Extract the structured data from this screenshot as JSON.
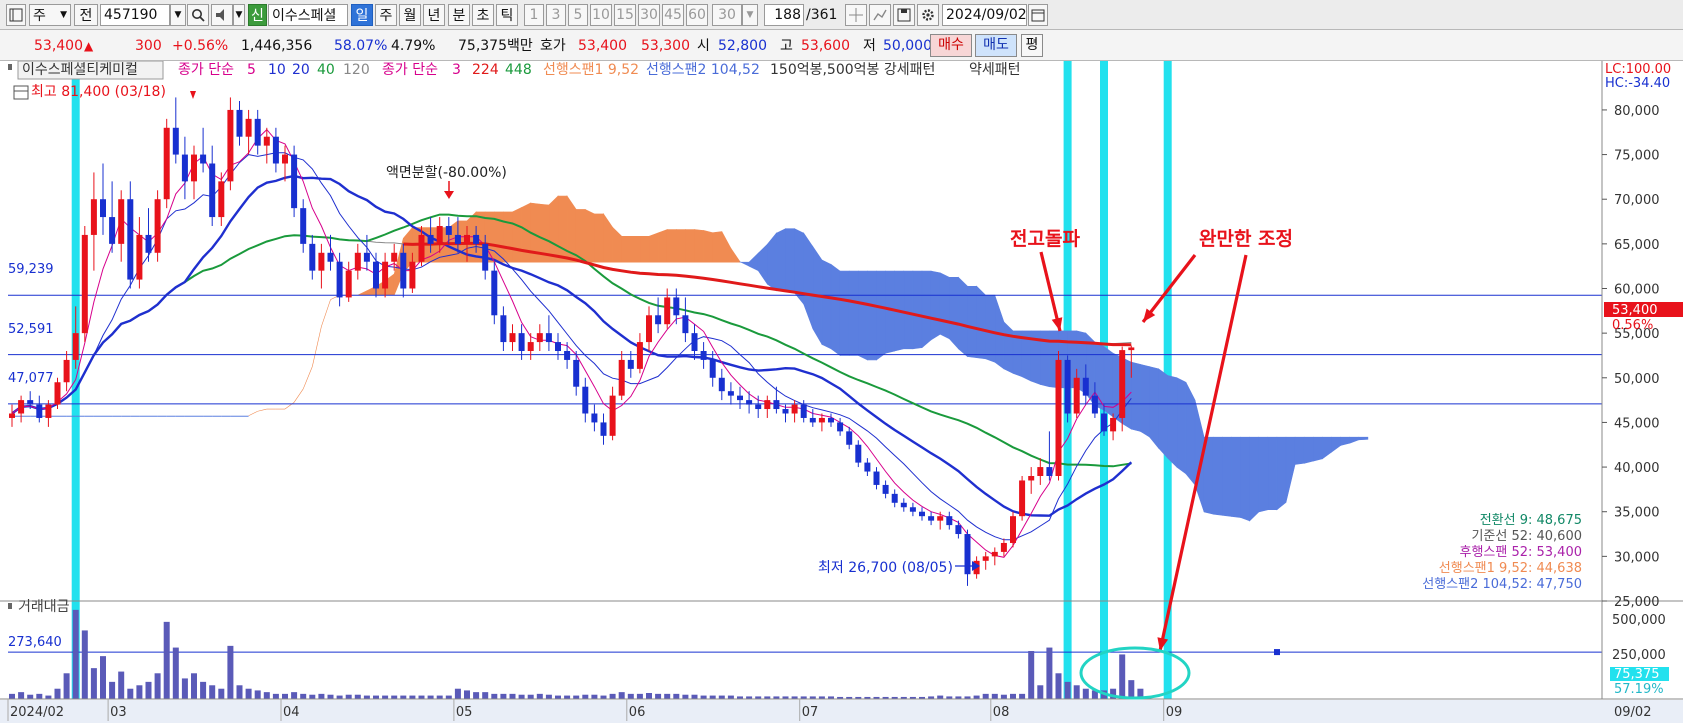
{
  "toolbar": {
    "market": "주",
    "prev": "전",
    "code": "457190",
    "shin": "신",
    "name": "이수스페셜",
    "periods": [
      "일",
      "주",
      "월",
      "년",
      "분",
      "초",
      "틱"
    ],
    "minutes": [
      "1",
      "3",
      "5",
      "10",
      "15",
      "30",
      "45",
      "60"
    ],
    "interval": "30",
    "count": "188",
    "total": "/361",
    "date": "2024/09/02"
  },
  "quote": {
    "price": "53,400",
    "arrow": "▲",
    "change": "300",
    "rate": "+0.56%",
    "volume": "1,446,356",
    "volume_ratio": "58.07%",
    "turnover": "4.79%",
    "amount": "75,375백만",
    "hoga_label": "호가",
    "ask": "53,400",
    "bid": "53,300",
    "open_label": "시",
    "open": "52,800",
    "high_label": "고",
    "high": "53,600",
    "low_label": "저",
    "low": "50,000",
    "buy_btn": "매수",
    "sell_btn": "매도",
    "avg_btn": "평"
  },
  "colors": {
    "up": "#e8121b",
    "down": "#1830d0",
    "cloud_up": "#f08b52",
    "cloud_down": "#5b7fe0",
    "highlight": "#22e1ee",
    "ma5": "#d7008c",
    "ma20": "#1f2fcf",
    "ma40": "#1a9a3c",
    "ma120": "#888888",
    "ma224": "#e01a1a",
    "annot": "#e8121b"
  },
  "chart_data": {
    "type": "candlestick",
    "title": "이수스페셜티케미컬",
    "legend": {
      "name": "이수스페셜티케미컬",
      "ma1_label": "종가 단순",
      "ma1_periods": [
        "5",
        "10",
        "20",
        "40",
        "120"
      ],
      "ma2_label": "종가 단순",
      "ma2_periods": [
        "3",
        "224",
        "448"
      ],
      "span1": "선행스팬1 9,52",
      "span2": "선행스팬2 104,52",
      "pattern": "150억봉,500억봉 강세패턴",
      "weak": "약세패턴"
    },
    "ylim": [
      25000,
      81000
    ],
    "yticks": [
      {
        "v": 25000,
        "label": "25,000"
      },
      {
        "v": 30000,
        "label": "30,000"
      },
      {
        "v": 35000,
        "label": "35,000"
      },
      {
        "v": 40000,
        "label": "40,000"
      },
      {
        "v": 45000,
        "label": "45,000"
      },
      {
        "v": 50000,
        "label": "50,000"
      },
      {
        "v": 55000,
        "label": "55,000"
      },
      {
        "v": 60000,
        "label": "60,000"
      },
      {
        "v": 65000,
        "label": "65,000"
      },
      {
        "v": 70000,
        "label": "70,000"
      },
      {
        "v": 75000,
        "label": "75,000"
      },
      {
        "v": 80000,
        "label": "80,000"
      }
    ],
    "months": [
      {
        "i": 0,
        "label": "2024/02"
      },
      {
        "i": 11,
        "label": "03"
      },
      {
        "i": 30,
        "label": "04"
      },
      {
        "i": 49,
        "label": "05"
      },
      {
        "i": 68,
        "label": "06"
      },
      {
        "i": 87,
        "label": "07"
      },
      {
        "i": 108,
        "label": "08"
      },
      {
        "i": 127,
        "label": "09"
      },
      {
        "i": 175,
        "label": "09/02"
      }
    ],
    "hlines": [
      {
        "v": 59239,
        "label": "59,239"
      },
      {
        "v": 52591,
        "label": "52,591"
      },
      {
        "v": 47077,
        "label": "47,077"
      }
    ],
    "max_label": "최고 81,400 (03/18)",
    "min_label": "최저 26,700 (08/05)",
    "split_label": "액면분할(-80.00%)",
    "annotation1": "전고돌파",
    "annotation2": "완만한 조정",
    "right_top": [
      "LC:100.00",
      "HC:-34.40"
    ],
    "price_badge": "53,400",
    "rate_badge": "0.56%",
    "info": [
      {
        "text": "전환선 9: 48,675",
        "color": "#118866"
      },
      {
        "text": "기준선 52: 40,600",
        "color": "#555555"
      },
      {
        "text": "후행스팬 52: 53,400",
        "color": "#aa22aa"
      },
      {
        "text": "선행스팬1 9,52: 44,638",
        "color": "#f08b52"
      },
      {
        "text": "선행스팬2 104,52: 47,750",
        "color": "#4a6cd8"
      }
    ],
    "highlights": [
      7,
      116,
      120,
      127
    ],
    "candles": [
      [
        45500,
        47000,
        44500,
        46000
      ],
      [
        46000,
        48000,
        45000,
        47500
      ],
      [
        47500,
        48500,
        46500,
        47000
      ],
      [
        47000,
        48000,
        45000,
        45500
      ],
      [
        45500,
        47500,
        44500,
        47000
      ],
      [
        47000,
        50000,
        46500,
        49500
      ],
      [
        49500,
        53000,
        48500,
        52000
      ],
      [
        52000,
        58000,
        51000,
        55000
      ],
      [
        55000,
        67000,
        54000,
        66000
      ],
      [
        66000,
        73000,
        62000,
        70000
      ],
      [
        70000,
        74000,
        66000,
        68000
      ],
      [
        68000,
        72000,
        64000,
        65000
      ],
      [
        65000,
        71000,
        63000,
        70000
      ],
      [
        70000,
        72000,
        60000,
        61000
      ],
      [
        61000,
        68000,
        60000,
        66000
      ],
      [
        66000,
        69000,
        63000,
        64000
      ],
      [
        64000,
        71000,
        63000,
        70000
      ],
      [
        70000,
        79000,
        69000,
        78000
      ],
      [
        78000,
        81400,
        74000,
        75000
      ],
      [
        75000,
        77000,
        70000,
        72000
      ],
      [
        72000,
        76000,
        70000,
        75000
      ],
      [
        75000,
        78000,
        73000,
        74000
      ],
      [
        74000,
        76000,
        67000,
        68000
      ],
      [
        68000,
        73000,
        67000,
        72000
      ],
      [
        72000,
        81400,
        71000,
        80000
      ],
      [
        80000,
        81000,
        76000,
        77000
      ],
      [
        77000,
        80000,
        75000,
        79000
      ],
      [
        79000,
        80000,
        75000,
        76000
      ],
      [
        76000,
        78000,
        74000,
        77000
      ],
      [
        77000,
        78000,
        73000,
        74000
      ],
      [
        74000,
        76000,
        72000,
        75000
      ],
      [
        75000,
        76000,
        68000,
        69000
      ],
      [
        69000,
        70000,
        64000,
        65000
      ],
      [
        65000,
        66000,
        61000,
        62000
      ],
      [
        62000,
        65000,
        60000,
        64000
      ],
      [
        64000,
        66000,
        62000,
        63000
      ],
      [
        63000,
        64000,
        58000,
        59000
      ],
      [
        59000,
        63000,
        58500,
        62000
      ],
      [
        62000,
        65000,
        61000,
        64000
      ],
      [
        64000,
        66000,
        62000,
        63000
      ],
      [
        63000,
        64000,
        59000,
        60000
      ],
      [
        60000,
        64000,
        59000,
        63000
      ],
      [
        63000,
        65000,
        62000,
        64000
      ],
      [
        64000,
        65000,
        59000,
        60000
      ],
      [
        60000,
        64000,
        59500,
        63000
      ],
      [
        63000,
        67000,
        62500,
        66000
      ],
      [
        66000,
        68000,
        64000,
        65000
      ],
      [
        65000,
        68000,
        64000,
        67000
      ],
      [
        67000,
        68000,
        65000,
        66000
      ],
      [
        66000,
        68000,
        64000,
        65000
      ],
      [
        65000,
        67000,
        63000,
        66000
      ],
      [
        66000,
        67000,
        64000,
        65000
      ],
      [
        65000,
        66000,
        61000,
        62000
      ],
      [
        62000,
        63000,
        56000,
        57000
      ],
      [
        57000,
        58000,
        53000,
        54000
      ],
      [
        54000,
        56000,
        53000,
        55000
      ],
      [
        55000,
        56000,
        52000,
        53000
      ],
      [
        53000,
        55000,
        52000,
        54000
      ],
      [
        54000,
        56000,
        53000,
        55000
      ],
      [
        55000,
        57000,
        53000,
        54000
      ],
      [
        54000,
        55000,
        52000,
        53000
      ],
      [
        53000,
        54000,
        51000,
        52000
      ],
      [
        52000,
        53000,
        48000,
        49000
      ],
      [
        49000,
        50000,
        45000,
        46000
      ],
      [
        46000,
        47000,
        44000,
        45000
      ],
      [
        45000,
        46000,
        42500,
        43500
      ],
      [
        43500,
        49000,
        43000,
        48000
      ],
      [
        48000,
        53000,
        47500,
        52000
      ],
      [
        52000,
        53000,
        50000,
        51000
      ],
      [
        51000,
        55000,
        50500,
        54000
      ],
      [
        54000,
        58000,
        53000,
        57000
      ],
      [
        57000,
        59000,
        55000,
        56000
      ],
      [
        56000,
        60000,
        55500,
        59000
      ],
      [
        59000,
        60000,
        56000,
        57000
      ],
      [
        57000,
        59000,
        54000,
        55000
      ],
      [
        55000,
        56000,
        52000,
        53000
      ],
      [
        53000,
        54000,
        51000,
        52000
      ],
      [
        52000,
        53000,
        49000,
        50000
      ],
      [
        50000,
        51000,
        47500,
        48500
      ],
      [
        48500,
        49500,
        47000,
        48000
      ],
      [
        48000,
        49000,
        46500,
        47500
      ],
      [
        47500,
        48500,
        46000,
        47000
      ],
      [
        47000,
        48000,
        45500,
        46500
      ],
      [
        46500,
        48000,
        45500,
        47500
      ],
      [
        47500,
        49000,
        46000,
        46500
      ],
      [
        46500,
        47000,
        45000,
        46000
      ],
      [
        46000,
        47500,
        45000,
        47000
      ],
      [
        47000,
        47500,
        45000,
        45500
      ],
      [
        45500,
        46500,
        44500,
        45000
      ],
      [
        45000,
        46000,
        44000,
        45500
      ],
      [
        45500,
        46000,
        44500,
        45000
      ],
      [
        45000,
        45500,
        43500,
        44000
      ],
      [
        44000,
        44500,
        42000,
        42500
      ],
      [
        42500,
        43000,
        40000,
        40500
      ],
      [
        40500,
        41000,
        39000,
        39500
      ],
      [
        39500,
        40000,
        37500,
        38000
      ],
      [
        38000,
        38500,
        36500,
        37000
      ],
      [
        37000,
        37500,
        35500,
        36000
      ],
      [
        36000,
        36500,
        35000,
        35500
      ],
      [
        35500,
        36000,
        34500,
        35000
      ],
      [
        35000,
        35500,
        34000,
        34500
      ],
      [
        34500,
        35000,
        33500,
        34000
      ],
      [
        34000,
        35000,
        33000,
        34500
      ],
      [
        34500,
        35000,
        33000,
        33500
      ],
      [
        33500,
        34000,
        32000,
        32500
      ],
      [
        32500,
        33000,
        26700,
        28000
      ],
      [
        28000,
        30000,
        27500,
        29500
      ],
      [
        29500,
        30500,
        28500,
        30000
      ],
      [
        30000,
        31000,
        29000,
        30500
      ],
      [
        30500,
        32000,
        30000,
        31500
      ],
      [
        31500,
        35000,
        31000,
        34500
      ],
      [
        34500,
        39000,
        34000,
        38500
      ],
      [
        38500,
        40000,
        37000,
        39000
      ],
      [
        39000,
        41000,
        38000,
        40000
      ],
      [
        40000,
        44000,
        38500,
        39000
      ],
      [
        39000,
        53000,
        38500,
        52000
      ],
      [
        52000,
        52500,
        45000,
        46000
      ],
      [
        46000,
        51000,
        45500,
        50000
      ],
      [
        50000,
        51500,
        47000,
        48000
      ],
      [
        48000,
        49500,
        45500,
        46000
      ],
      [
        46000,
        47000,
        43500,
        44000
      ],
      [
        44000,
        46000,
        43000,
        45500
      ],
      [
        45500,
        53500,
        44000,
        53100
      ],
      [
        53100,
        53600,
        50000,
        53400
      ]
    ],
    "volume": {
      "label": "거래대금",
      "line_value": 273640,
      "line_label": "273,640",
      "ticks": [
        {
          "v": 500000,
          "label": "500,000"
        },
        {
          "v": 250000,
          "label": "250,000"
        }
      ],
      "badge": "75,375",
      "badge_rate": "57.19%",
      "values": [
        30000,
        40000,
        25000,
        30000,
        20000,
        60000,
        150000,
        520000,
        400000,
        180000,
        250000,
        100000,
        160000,
        60000,
        80000,
        100000,
        150000,
        450000,
        300000,
        120000,
        150000,
        100000,
        80000,
        60000,
        310000,
        80000,
        60000,
        50000,
        40000,
        30000,
        30000,
        40000,
        30000,
        25000,
        30000,
        25000,
        20000,
        25000,
        25000,
        20000,
        20000,
        20000,
        20000,
        20000,
        20000,
        20000,
        20000,
        20000,
        20000,
        60000,
        50000,
        40000,
        40000,
        30000,
        30000,
        30000,
        25000,
        25000,
        30000,
        25000,
        20000,
        20000,
        20000,
        25000,
        25000,
        20000,
        30000,
        40000,
        30000,
        30000,
        35000,
        30000,
        30000,
        30000,
        25000,
        25000,
        20000,
        20000,
        20000,
        20000,
        15000,
        15000,
        15000,
        15000,
        15000,
        15000,
        15000,
        15000,
        15000,
        15000,
        15000,
        12000,
        12000,
        12000,
        12000,
        12000,
        12000,
        12000,
        12000,
        12000,
        12000,
        15000,
        20000,
        15000,
        15000,
        15000,
        20000,
        30000,
        30000,
        25000,
        30000,
        30000,
        280000,
        80000,
        300000,
        150000,
        100000,
        80000,
        60000,
        50000,
        50000,
        60000,
        260000,
        110000,
        60000
      ]
    }
  }
}
